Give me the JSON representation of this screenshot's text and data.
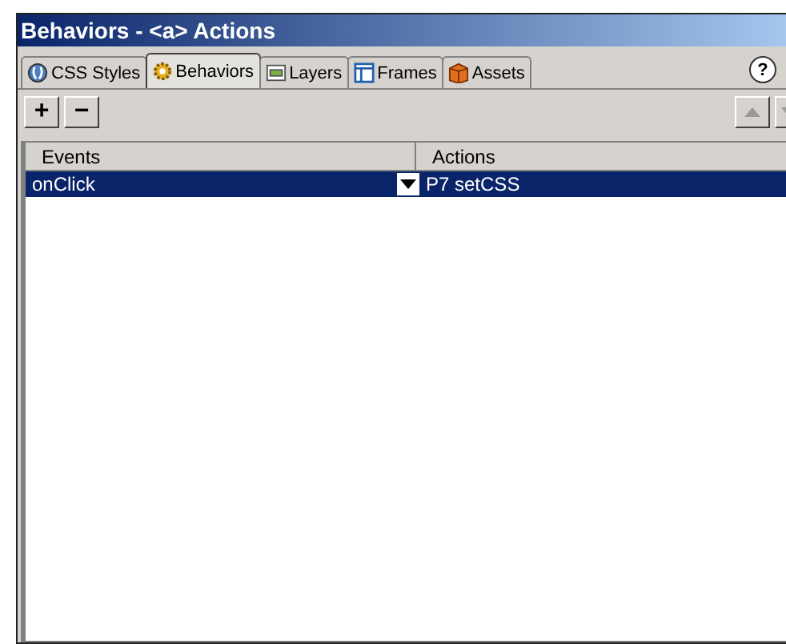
{
  "window": {
    "title": "Behaviors - <a> Actions"
  },
  "tabs": [
    {
      "label": "CSS Styles",
      "kind": "css",
      "selected": false
    },
    {
      "label": "Behaviors",
      "kind": "behaviors",
      "selected": true
    },
    {
      "label": "Layers",
      "kind": "layers",
      "selected": false
    },
    {
      "label": "Frames",
      "kind": "frames",
      "selected": false
    },
    {
      "label": "Assets",
      "kind": "assets",
      "selected": false
    }
  ],
  "help": {
    "label": "?"
  },
  "toolbar": {
    "add": "+",
    "remove": "−"
  },
  "table": {
    "columns": [
      "Events",
      "Actions"
    ],
    "rows": [
      {
        "event": "onClick",
        "action": "P7 setCSS",
        "selected": true
      }
    ]
  }
}
